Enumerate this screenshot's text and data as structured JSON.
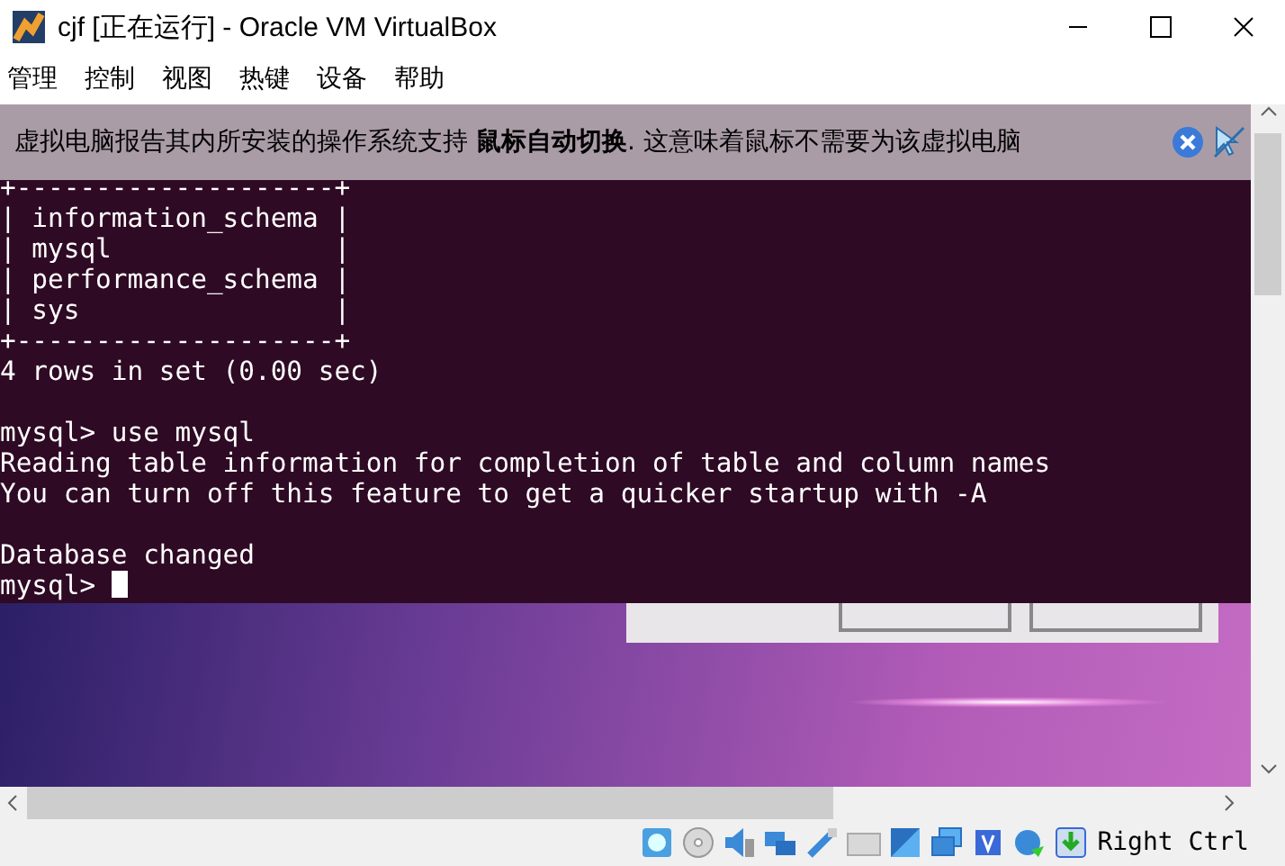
{
  "window": {
    "title": "cjf [正在运行] - Oracle VM VirtualBox"
  },
  "menu": [
    "管理",
    "控制",
    "视图",
    "热键",
    "设备",
    "帮助"
  ],
  "notification": {
    "text": "虚拟电脑报告其内所安装的操作系统支持 **鼠标自动切换**. 这意味着鼠标不需要为该虚拟电脑"
  },
  "terminal": {
    "blocks": [
      [
        "+--------------------+",
        "| information_schema |",
        "| mysql              |",
        "| performance_schema |",
        "| sys                |",
        "+--------------------+",
        "4 rows in set (0.00 sec)"
      ],
      [
        "mysql> use mysql",
        "Reading table information for completion of table and column names",
        "You can turn off this feature to get a quicker startup with -A"
      ],
      [
        "Database changed"
      ]
    ],
    "prompt": "mysql>"
  },
  "status_bar": {
    "host_key": "Right Ctrl"
  }
}
